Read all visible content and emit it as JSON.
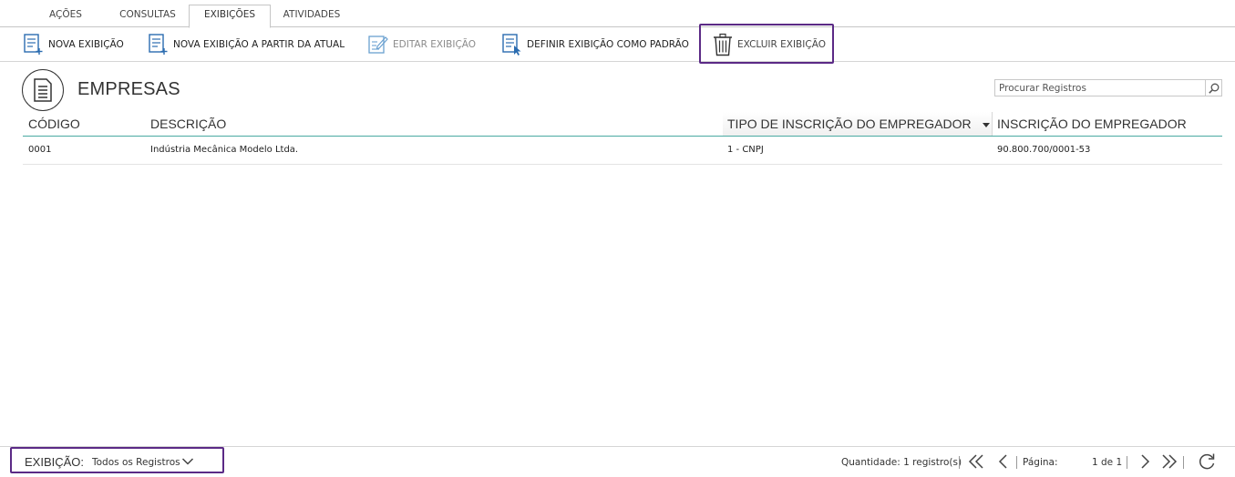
{
  "tabs": [
    {
      "label": "AÇÕES"
    },
    {
      "label": "CONSULTAS"
    },
    {
      "label": "EXIBIÇÕES",
      "active": true
    },
    {
      "label": "ATIVIDADES"
    }
  ],
  "ribbon": {
    "new_view": "NOVA EXIBIÇÃO",
    "new_view_from_current": "NOVA EXIBIÇÃO A PARTIR DA ATUAL",
    "edit_view": "EDITAR EXIBIÇÃO",
    "set_default_view": "DEFINIR EXIBIÇÃO COMO PADRÃO",
    "delete_view": "EXCLUIR EXIBIÇÃO"
  },
  "page": {
    "title": "EMPRESAS",
    "icon": "document-icon"
  },
  "search": {
    "placeholder": "Procurar Registros",
    "icon": "search-icon"
  },
  "table": {
    "columns": [
      "CÓDIGO",
      "DESCRIÇÃO",
      "TIPO DE INSCRIÇÃO DO EMPREGADOR",
      "INSCRIÇÃO DO EMPREGADOR"
    ],
    "rows": [
      [
        "0001",
        "Indústria Mecânica Modelo Ltda.",
        "1 - CNPJ",
        "90.800.700/0001-53"
      ]
    ]
  },
  "footer": {
    "view_label": "EXIBIÇÃO:",
    "view_value": "Todos os Registros",
    "quantity": "Quantidade: 1 registro(s)",
    "page_label": "Página:",
    "page_value": "1 de 1"
  },
  "colors": {
    "highlight": "#5b2a86",
    "header_underline": "#4aa9a1",
    "icon_blue": "#2b6cb0"
  }
}
